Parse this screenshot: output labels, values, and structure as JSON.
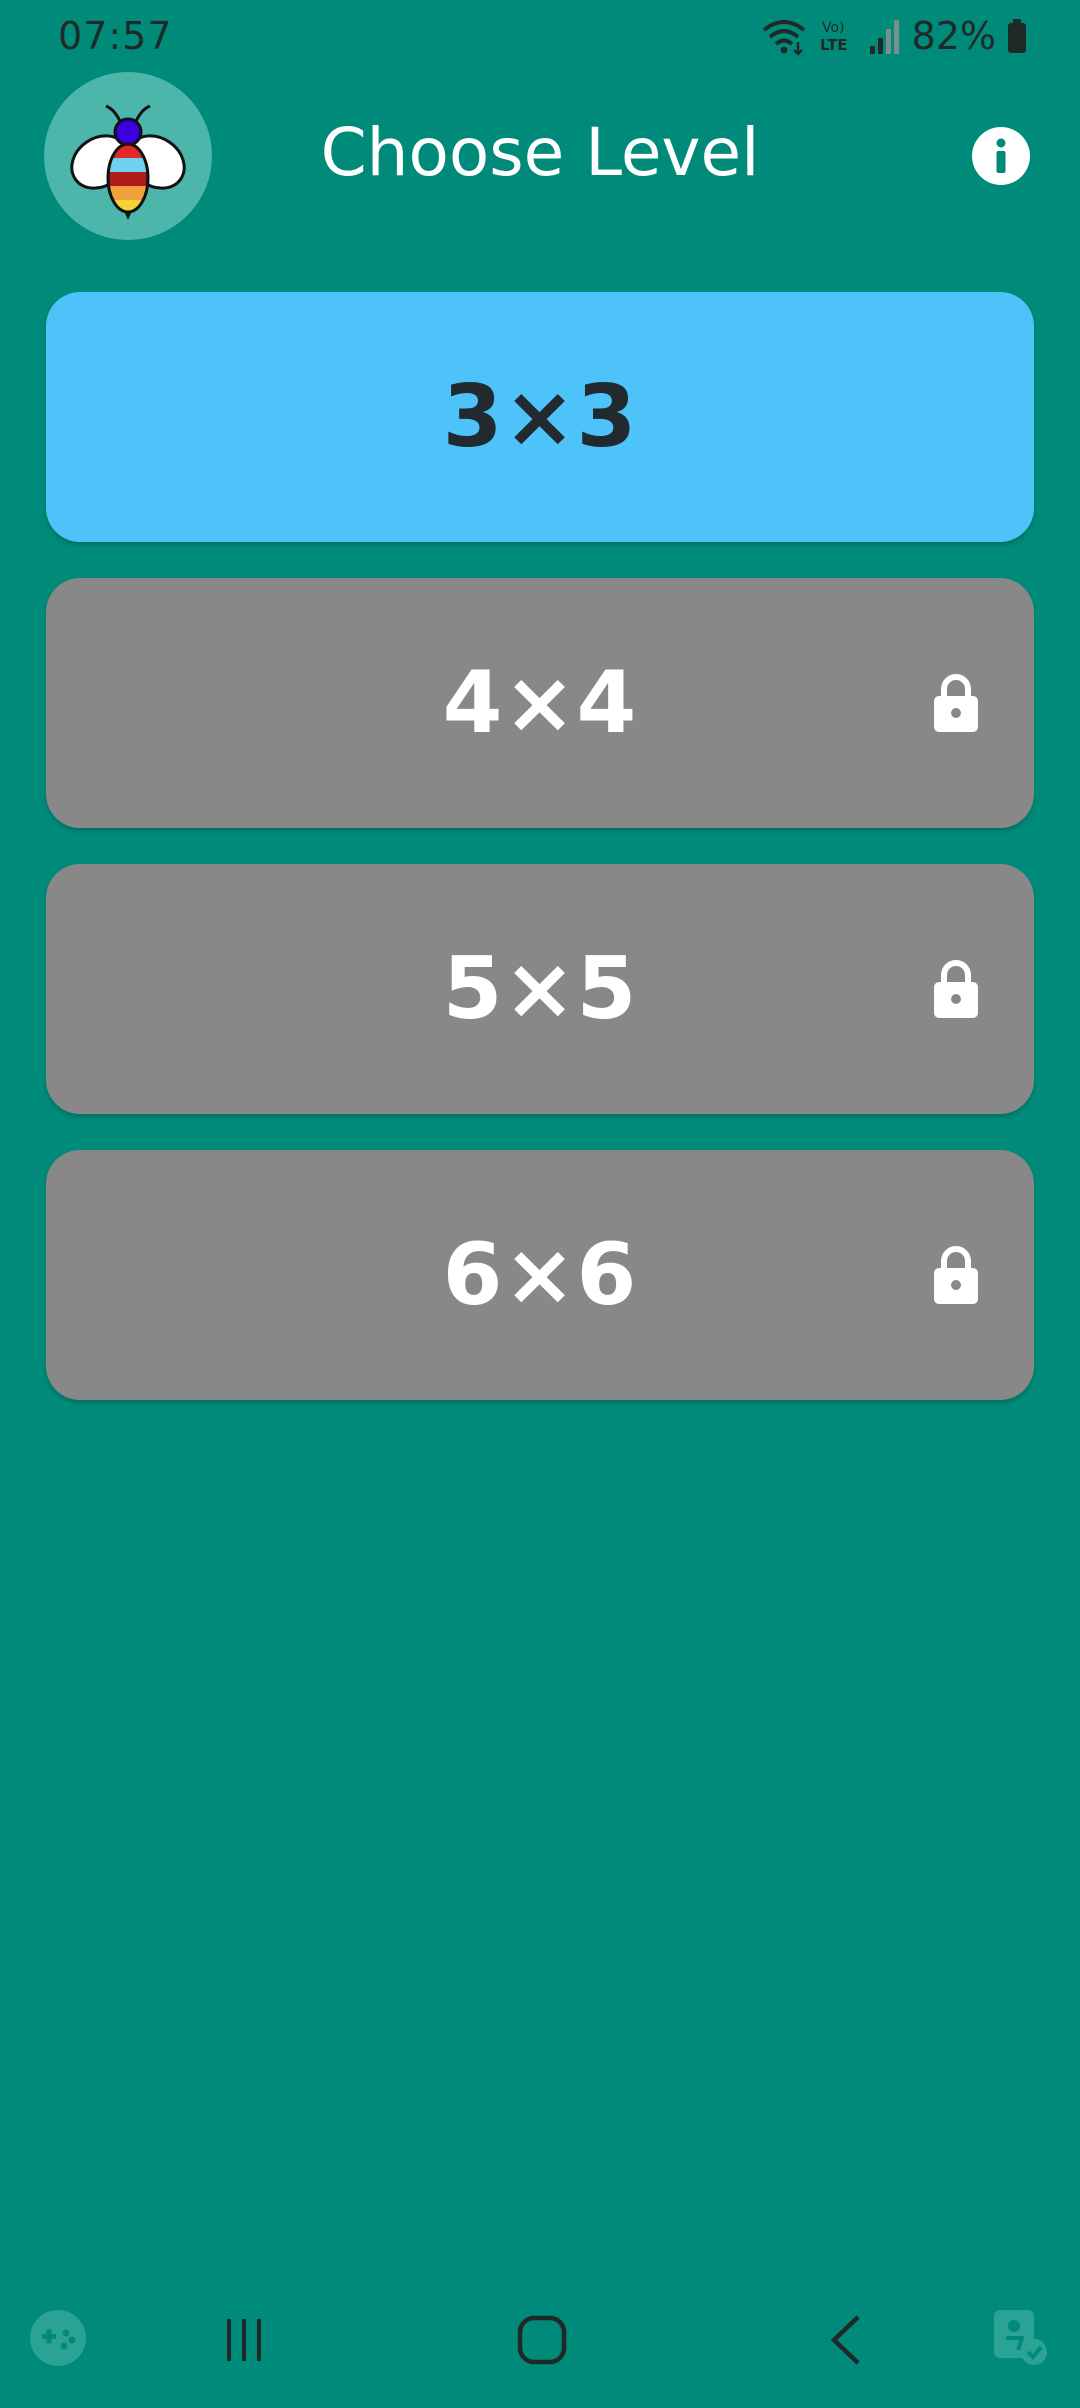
{
  "status_bar": {
    "time": "07:57",
    "battery": "82%",
    "network_label": "Vo) LTE",
    "icons": [
      "wifi-icon",
      "lte-icon",
      "signal-icon",
      "battery-icon"
    ]
  },
  "header": {
    "title": "Choose Level",
    "logo_icon": "bee-logo-icon",
    "info_icon": "info-icon"
  },
  "levels": [
    {
      "label": "3×3",
      "locked": false
    },
    {
      "label": "4×4",
      "locked": true
    },
    {
      "label": "5×5",
      "locked": true
    },
    {
      "label": "6×6",
      "locked": true
    }
  ],
  "nav_bar": {
    "icons": [
      "game-launcher-icon",
      "recent-apps-icon",
      "home-icon",
      "back-icon",
      "accessibility-icon"
    ]
  },
  "colors": {
    "background": "#008A79",
    "logo_circle": "#4BB6A9",
    "unlocked_card": "#4EC3FA",
    "locked_card": "#888888"
  }
}
